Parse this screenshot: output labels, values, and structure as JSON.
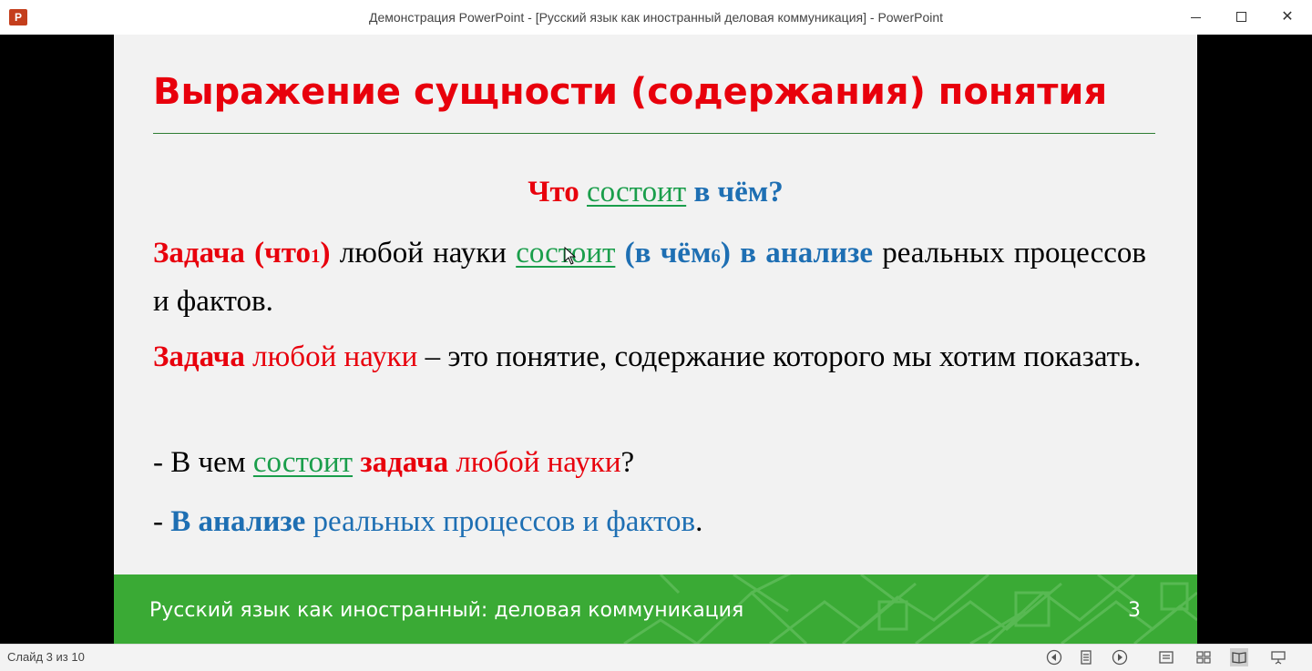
{
  "window": {
    "title": "Демонстрация PowerPoint - [Русский язык как иностранный деловая коммуникация] - PowerPoint",
    "app_icon": "powerpoint-icon",
    "app_icon_letter": "P"
  },
  "slide": {
    "title": "Выражение сущности (содержания) понятия",
    "question": {
      "w1": "Что",
      "w2": "состоит",
      "w3": "в чём?"
    },
    "para1": {
      "w1": "Задача (что",
      "n1": "1",
      "w2": ")",
      "w3": "любой науки",
      "w4": "состоит",
      "w5": "(в чём",
      "n2": "6",
      "w6": ")",
      "w7": "в анализе",
      "w8": "реальных процессов и фактов."
    },
    "para2": {
      "w1": "Задача",
      "w2": "любой науки",
      "w3": "– это понятие, содержание которого мы хотим показать."
    },
    "line3": {
      "w1": "- В чем",
      "w2": "состоит",
      "w3": "задача",
      "w4": "любой науки",
      "w5": "?"
    },
    "line4": {
      "w1": "-",
      "w2": "В анализе",
      "w3": "реальных процессов и фактов",
      "w4": "."
    },
    "footer_text": "Русский язык как иностранный: деловая коммуникация",
    "number": "3"
  },
  "colors": {
    "title_red": "#e8000c",
    "accent_blue": "#1e6fb3",
    "accent_green": "#1a9e4b",
    "footer_green": "#3aaa35"
  },
  "statusbar": {
    "slide_counter": "Слайд 3 из 10",
    "icons": [
      "previous-icon",
      "slide-menu-icon",
      "next-icon",
      "normal-view-icon",
      "slide-sorter-icon",
      "reading-view-icon",
      "slideshow-icon"
    ]
  }
}
